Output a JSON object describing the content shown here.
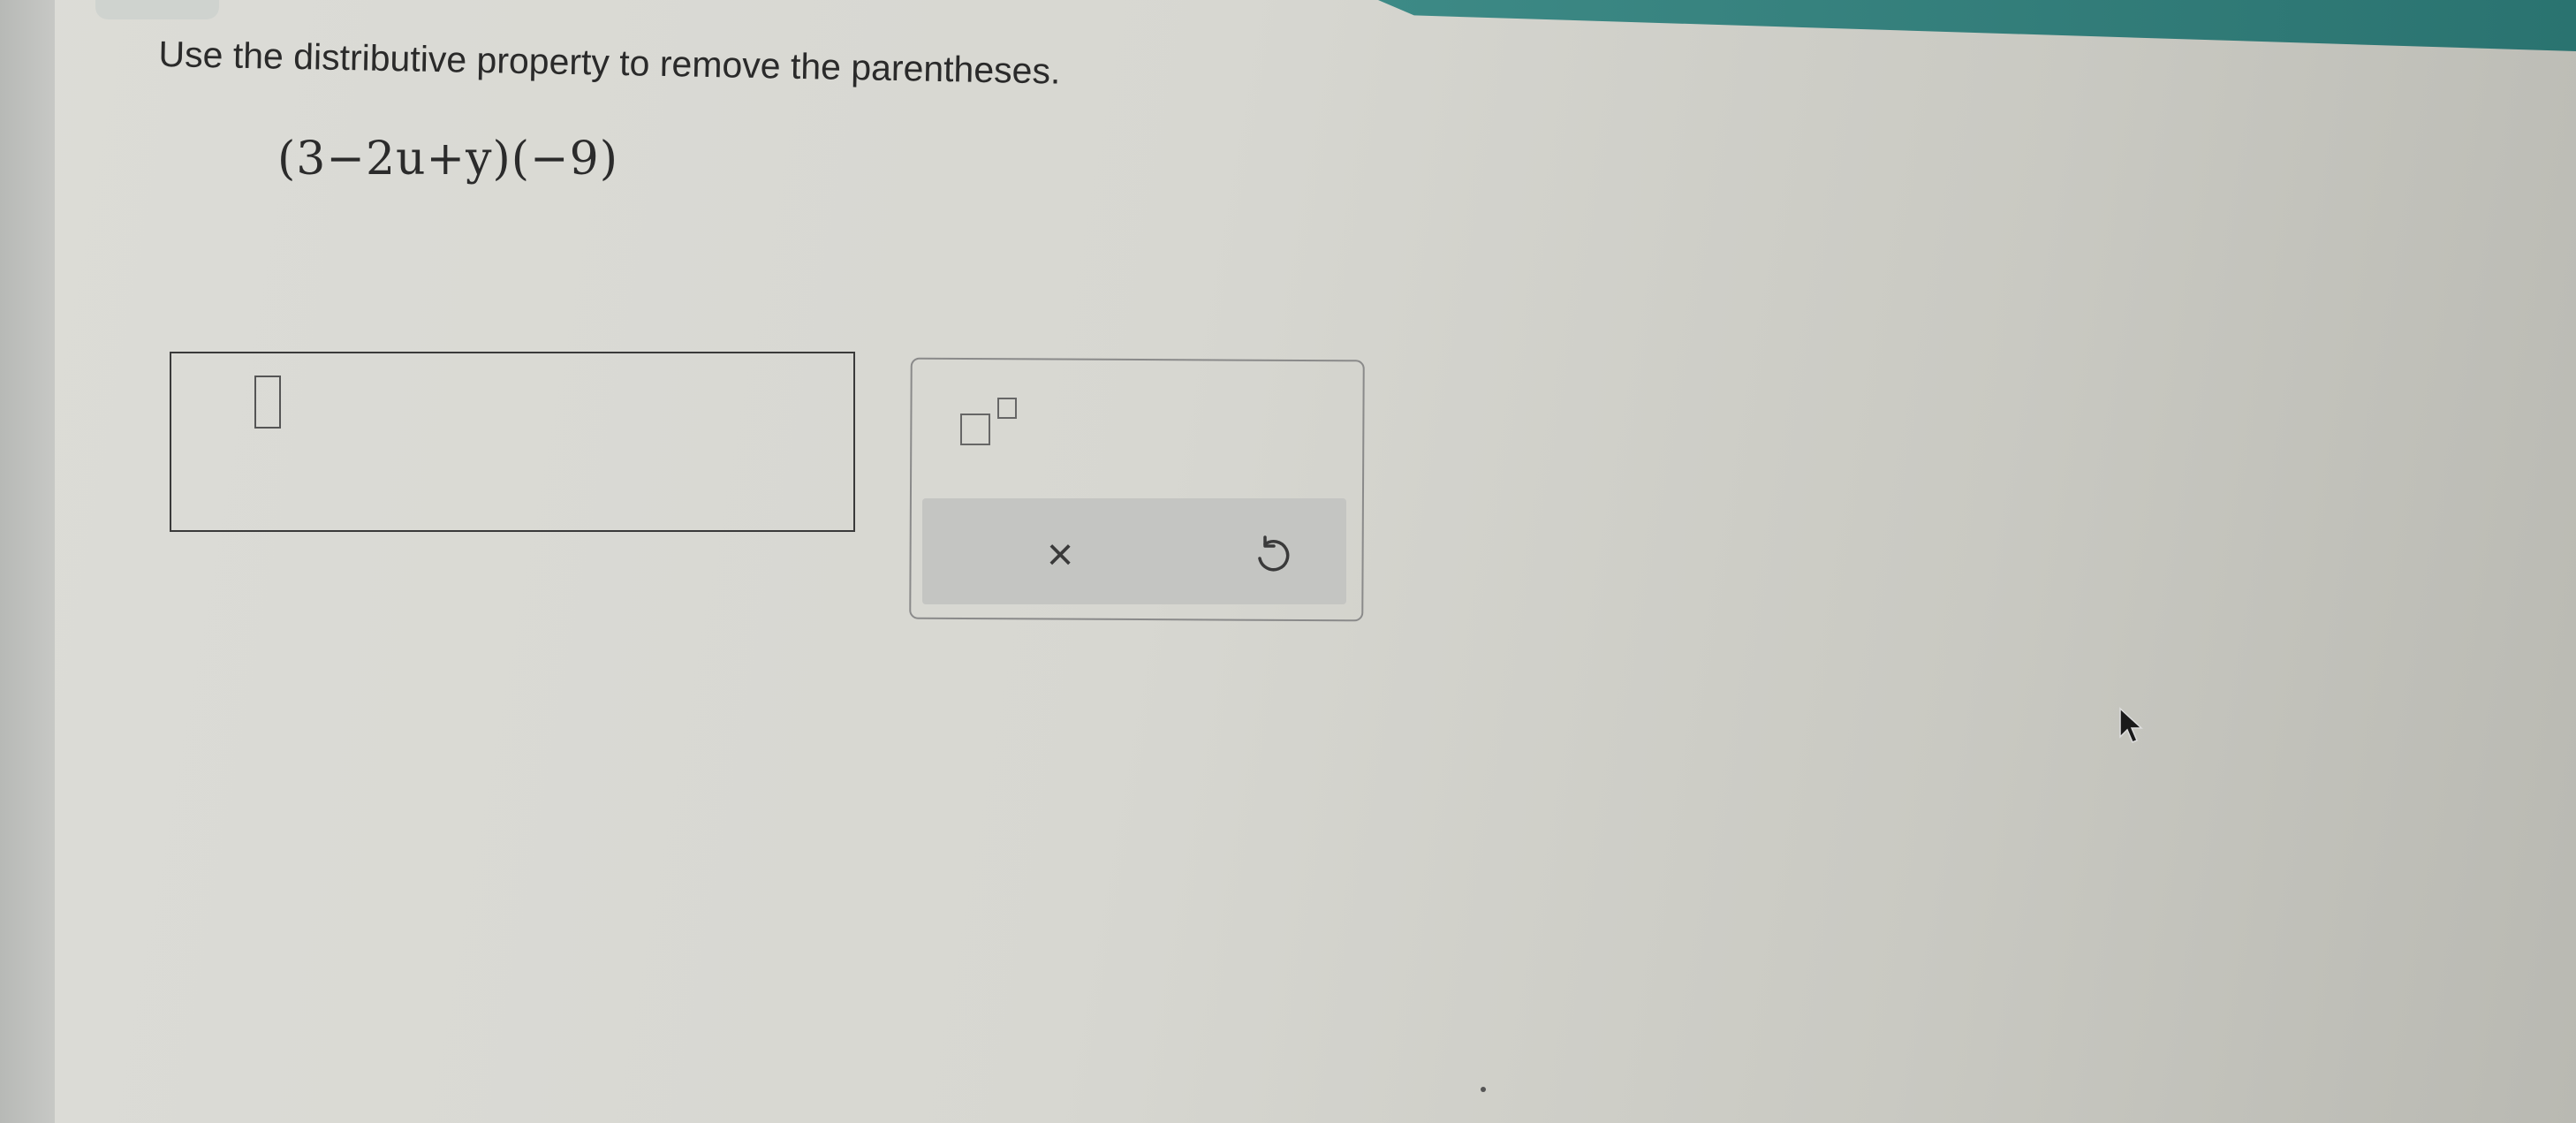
{
  "question": {
    "instruction": "Use the distributive property to remove the parentheses.",
    "expression": "(3−2u+y)(−9)"
  },
  "answer": {
    "value": ""
  },
  "palette": {
    "exponent_icon": "superscript-template-icon",
    "clear_icon": "close-icon",
    "clear_symbol": "×",
    "undo_icon": "undo-icon"
  },
  "colors": {
    "accent_bar": "#2a7370"
  }
}
